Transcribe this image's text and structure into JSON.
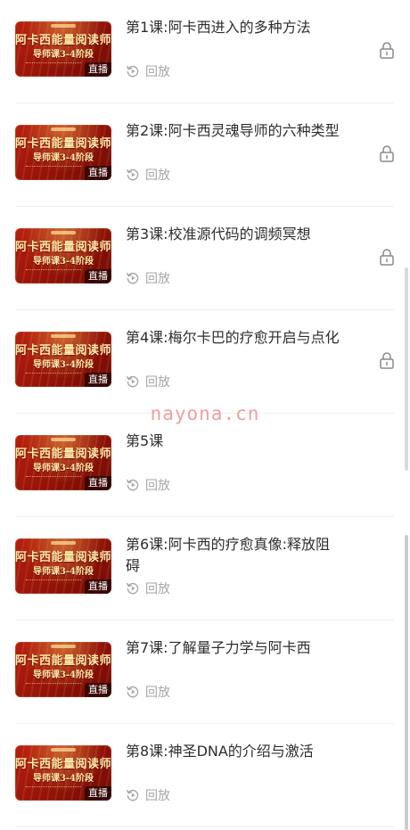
{
  "watermark": "nayona.cn",
  "thumbnail": {
    "title_line1": "阿卡西能量阅读师",
    "title_line2": "导师课3-4阶段",
    "badge": "直播"
  },
  "colors": {
    "thumb_red": "#a5180b",
    "thumb_gold": "#ffe9a8",
    "replay_gray": "#a6a6a6",
    "lock_gray": "#8a8a8a"
  },
  "lessons": [
    {
      "title": "第1课:阿卡西进入的多种方法",
      "replay_label": "回放",
      "badge": "直播",
      "locked": true,
      "lock_icon": "lock-icon",
      "replay_icon": "replay-icon"
    },
    {
      "title": "第2课:阿卡西灵魂导师的六种类型",
      "replay_label": "回放",
      "badge": "直播",
      "locked": true,
      "lock_icon": "lock-icon",
      "replay_icon": "replay-icon"
    },
    {
      "title": "第3课:校准源代码的调频冥想",
      "replay_label": "回放",
      "badge": "直播",
      "locked": true,
      "lock_icon": "lock-icon",
      "replay_icon": "replay-icon"
    },
    {
      "title": "第4课:梅尔卡巴的疗愈开启与点化",
      "replay_label": "回放",
      "badge": "直播",
      "locked": true,
      "lock_icon": "lock-icon",
      "replay_icon": "replay-icon"
    },
    {
      "title": "第5课",
      "replay_label": "回放",
      "badge": "直播",
      "locked": false,
      "replay_icon": "replay-icon"
    },
    {
      "title": "第6课:阿卡西的疗愈真像:释放阻碍",
      "replay_label": "回放",
      "badge": "直播",
      "locked": false,
      "replay_icon": "replay-icon"
    },
    {
      "title": "第7课:了解量子力学与阿卡西",
      "replay_label": "回放",
      "badge": "直播",
      "locked": false,
      "replay_icon": "replay-icon"
    },
    {
      "title": "第8课:神圣DNA的介绍与激活",
      "replay_label": "回放",
      "badge": "直播",
      "locked": false,
      "replay_icon": "replay-icon"
    }
  ]
}
